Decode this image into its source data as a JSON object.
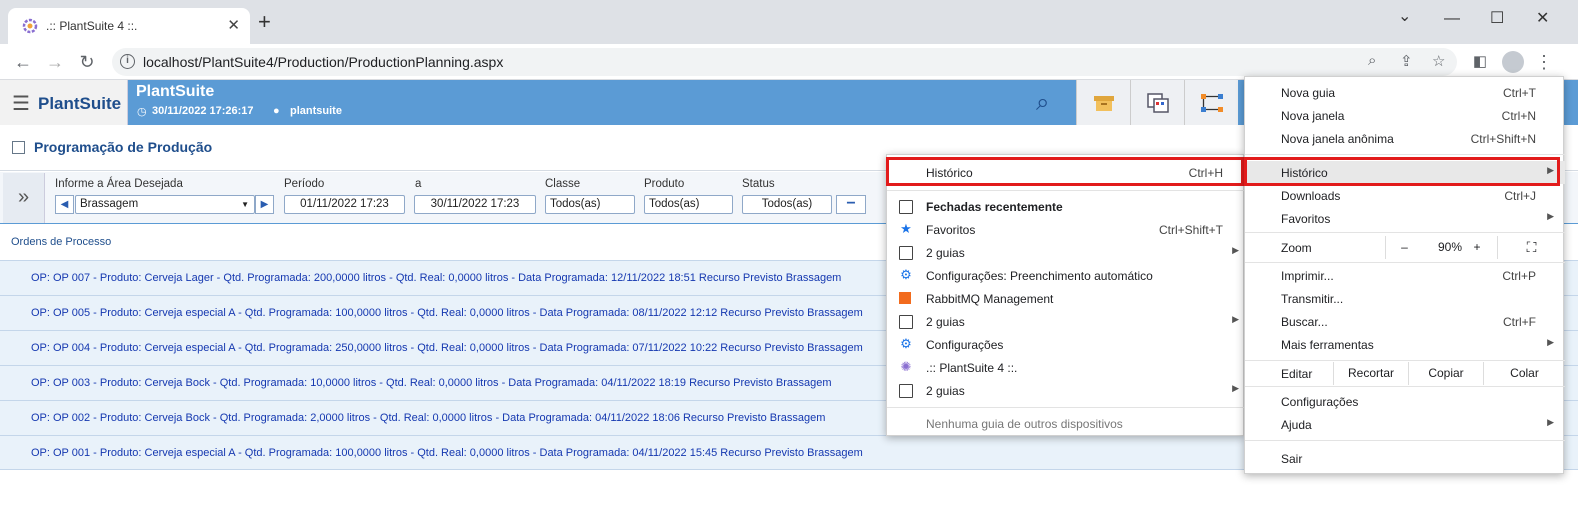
{
  "browser": {
    "tab_title": ".:: PlantSuite 4 ::.",
    "url": "localhost/PlantSuite4/Production/ProductionPlanning.aspx"
  },
  "app": {
    "logo": "PlantSuite",
    "title": "PlantSuite",
    "datetime": "30/11/2022 17:26:17",
    "user": "plantsuite"
  },
  "page": {
    "title": "Programação de Produção"
  },
  "filters": {
    "area_label": "Informe a Área Desejada",
    "area_value": "Brassagem",
    "period_label": "Período",
    "period_from": "01/11/2022 17:23",
    "period_to_label": "a",
    "period_to": "30/11/2022 17:23",
    "class_label": "Classe",
    "class_value": "Todos(as)",
    "product_label": "Produto",
    "product_value": "Todos(as)",
    "status_label": "Status",
    "status_value": "Todos(as)"
  },
  "orders": {
    "title": "Ordens de Processo",
    "rows": [
      "OP: OP 007 - Produto: Cerveja Lager - Qtd. Programada: 200,0000 litros - Qtd. Real: 0,0000 litros - Data Programada: 12/11/2022 18:51 Recurso Previsto Brassagem",
      "OP: OP 005 - Produto: Cerveja especial A - Qtd. Programada: 100,0000 litros - Qtd. Real: 0,0000 litros - Data Programada: 08/11/2022 12:12 Recurso Previsto Brassagem",
      "OP: OP 004 - Produto: Cerveja especial A - Qtd. Programada: 250,0000 litros - Qtd. Real: 0,0000 litros - Data Programada: 07/11/2022 10:22 Recurso Previsto Brassagem",
      "OP: OP 003 - Produto: Cerveja Bock - Qtd. Programada: 10,0000 litros - Qtd. Real: 0,0000 litros - Data Programada: 04/11/2022 18:19 Recurso Previsto Brassagem",
      "OP: OP 002 - Produto: Cerveja Bock - Qtd. Programada: 2,0000 litros - Qtd. Real: 0,0000 litros - Data Programada: 04/11/2022 18:06 Recurso Previsto Brassagem",
      "OP: OP 001 - Produto: Cerveja especial A - Qtd. Programada: 100,0000 litros - Qtd. Real: 0,0000 litros - Data Programada: 04/11/2022 15:45 Recurso Previsto Brassagem"
    ]
  },
  "history_menu": {
    "historico": "Histórico",
    "historico_sc": "Ctrl+H",
    "recent_header": "Fechadas recentemente",
    "favoritos": "Favoritos",
    "favoritos_sc": "Ctrl+Shift+T",
    "guias_1": "2 guias",
    "config_auto": "Configurações: Preenchimento automático",
    "rabbitmq": "RabbitMQ Management",
    "guias_2": "2 guias",
    "configuracoes": "Configurações",
    "plantsuite": ".:: PlantSuite 4 ::.",
    "guias_3": "2 guias",
    "no_devices": "Nenhuma guia de outros dispositivos"
  },
  "main_menu": {
    "nova_guia": "Nova guia",
    "nova_guia_sc": "Ctrl+T",
    "nova_janela": "Nova janela",
    "nova_janela_sc": "Ctrl+N",
    "anonima": "Nova janela anônima",
    "anonima_sc": "Ctrl+Shift+N",
    "historico": "Histórico",
    "downloads": "Downloads",
    "downloads_sc": "Ctrl+J",
    "favoritos": "Favoritos",
    "zoom": "Zoom",
    "zoom_minus": "–",
    "zoom_value": "90%",
    "zoom_plus": "+",
    "imprimir": "Imprimir...",
    "imprimir_sc": "Ctrl+P",
    "transmitir": "Transmitir...",
    "buscar": "Buscar...",
    "buscar_sc": "Ctrl+F",
    "mais_ferramentas": "Mais ferramentas",
    "editar": "Editar",
    "recortar": "Recortar",
    "copiar": "Copiar",
    "colar": "Colar",
    "configuracoes": "Configurações",
    "ajuda": "Ajuda",
    "sair": "Sair"
  }
}
